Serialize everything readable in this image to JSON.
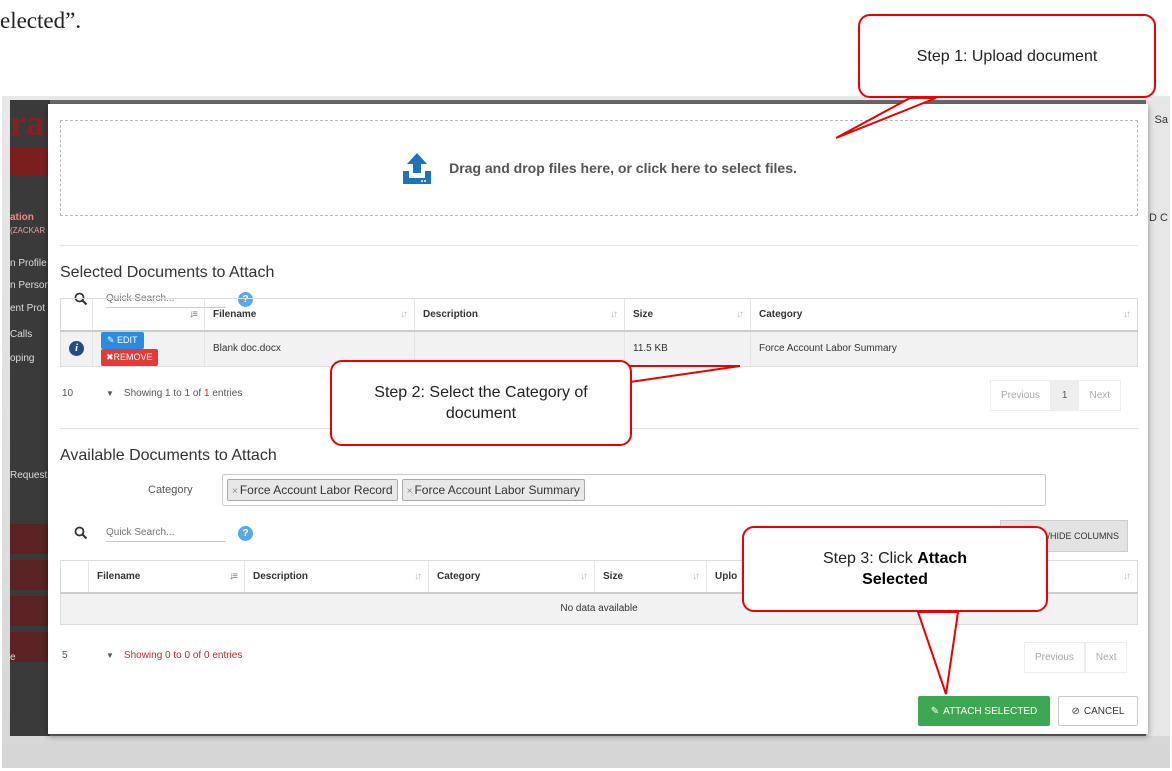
{
  "caption": "elected”.",
  "background": {
    "logo": "ran",
    "sidebar_items": [
      "ation",
      "(ZACKAR",
      "n Profile",
      "n Person",
      "ent Prot",
      "Calls",
      "oping",
      "Request",
      "e"
    ],
    "right_items": [
      "Sa",
      "D C"
    ]
  },
  "dropzone": {
    "text": "Drag and drop files here, or click here to select files."
  },
  "selected": {
    "title": "Selected Documents to Attach",
    "search_placeholder": "Quick Search...",
    "help": "?",
    "columns": [
      "Filename",
      "Description",
      "Size",
      "Category"
    ],
    "rows": [
      {
        "info": "i",
        "edit": "EDIT",
        "remove": "REMOVE",
        "filename": "Blank doc.docx",
        "description": "",
        "size": "11.5 KB",
        "category": "Force Account Labor Summary"
      }
    ],
    "page_length": "10",
    "info_prefix": "Showing 1 to 1 of ",
    "info_total": "1",
    "info_suffix": " entries",
    "pager": {
      "previous": "Previous",
      "current": "1",
      "next": "Next"
    }
  },
  "available": {
    "title": "Available Documents to Attach",
    "category_label": "Category",
    "chips": [
      "Force Account Labor Record",
      "Force Account Labor Summary"
    ],
    "search_placeholder": "Quick Search...",
    "help": "?",
    "show_hide": "/HIDE COLUMNS",
    "columns": [
      "Filename",
      "Description",
      "Category",
      "Size",
      "Uplo"
    ],
    "no_data": "No data available",
    "page_length": "5",
    "info": "Showing 0 to 0 of 0 entries",
    "pager": {
      "previous": "Previous",
      "next": "Next"
    }
  },
  "actions": {
    "attach": "ATTACH SELECTED",
    "cancel": "CANCEL"
  },
  "callouts": {
    "step1": "Step 1: Upload document",
    "step2": "Step 2: Select the Category of document",
    "step3_prefix": "Step 3: Click ",
    "step3_bold1": "Attach",
    "step3_bold2": "Selected"
  },
  "colors": {
    "accent_green": "#3ea752",
    "edit_blue": "#2b8be3",
    "remove_red": "#e53935",
    "callout_red": "#e00000"
  }
}
